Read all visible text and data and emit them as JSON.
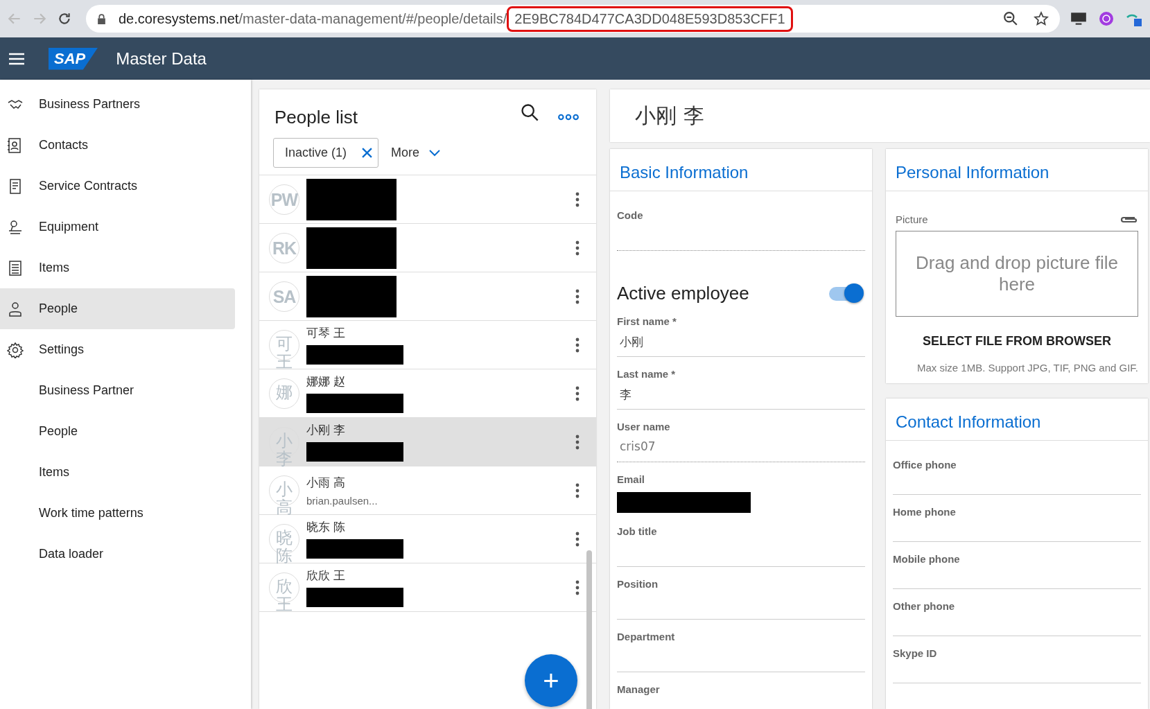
{
  "browser": {
    "url_host": "de.coresystems.net",
    "url_path": "/master-data-management/#/people/details/",
    "url_id": "2E9BC784D477CA3DD048E593D853CFF1",
    "id_highlighted": true
  },
  "app": {
    "logo": "SAP",
    "title": "Master Data"
  },
  "sidebar": {
    "items": [
      {
        "label": "Business Partners",
        "kind": "main",
        "selected": false
      },
      {
        "label": "Contacts",
        "kind": "main",
        "selected": false
      },
      {
        "label": "Service Contracts",
        "kind": "main",
        "selected": false
      },
      {
        "label": "Equipment",
        "kind": "main",
        "selected": false
      },
      {
        "label": "Items",
        "kind": "main",
        "selected": false
      },
      {
        "label": "People",
        "kind": "main",
        "selected": true
      },
      {
        "label": "Settings",
        "kind": "main",
        "selected": false
      },
      {
        "label": "Business Partner",
        "kind": "sub",
        "selected": false
      },
      {
        "label": "People",
        "kind": "sub",
        "selected": false
      },
      {
        "label": "Items",
        "kind": "sub",
        "selected": false
      },
      {
        "label": "Work time patterns",
        "kind": "sub",
        "selected": false
      },
      {
        "label": "Data loader",
        "kind": "sub",
        "selected": false
      }
    ]
  },
  "people_list": {
    "title": "People list",
    "filter": "Inactive (1)",
    "more": "More",
    "rows": [
      {
        "initials": "PW",
        "selected": false
      },
      {
        "initials": "RK",
        "selected": false
      },
      {
        "initials": "SA",
        "selected": false
      },
      {
        "initials": "可王",
        "name": "可琴 王",
        "selected": false
      },
      {
        "initials": "娜",
        "name": "娜娜 赵",
        "selected": false
      },
      {
        "initials": "小李",
        "name": "小刚 李",
        "selected": true
      },
      {
        "initials": "小高",
        "name": "小雨 高",
        "subtitle": "brian.paulsen...",
        "selected": false
      },
      {
        "initials": "晓陈",
        "name": "晓东 陈",
        "selected": false
      },
      {
        "initials": "欣王",
        "name": "欣欣 王",
        "selected": false
      }
    ],
    "add_button": "+"
  },
  "details": {
    "title": "小刚 李",
    "basic": {
      "title": "Basic Information",
      "fields": [
        {
          "kind": "field",
          "label": "Code",
          "disabled": true
        },
        {
          "kind": "toggle",
          "label": "Active employee",
          "on": true
        },
        {
          "kind": "field",
          "label": "First name *",
          "value": "小刚",
          "disabled": false
        },
        {
          "kind": "field",
          "label": "Last name *",
          "value": "李",
          "disabled": false
        },
        {
          "kind": "field",
          "label": "User name",
          "value": "cris07",
          "disabled": true
        },
        {
          "kind": "redacted",
          "label": "Email"
        },
        {
          "kind": "field",
          "label": "Job title",
          "disabled": false
        },
        {
          "kind": "field",
          "label": "Position",
          "disabled": false
        },
        {
          "kind": "field",
          "label": "Department",
          "disabled": false
        },
        {
          "kind": "label",
          "label": "Manager"
        }
      ]
    },
    "personal": {
      "title": "Personal Information",
      "picture_label": "Picture",
      "drop_text": "Drag and drop picture file here",
      "select_button": "SELECT FILE FROM BROWSER",
      "hint": "Max size 1MB. Support JPG, TIF, PNG and GIF."
    },
    "contact": {
      "title": "Contact Information",
      "fields": [
        "Office phone",
        "Home phone",
        "Mobile phone",
        "Other phone",
        "Skype ID"
      ]
    }
  }
}
